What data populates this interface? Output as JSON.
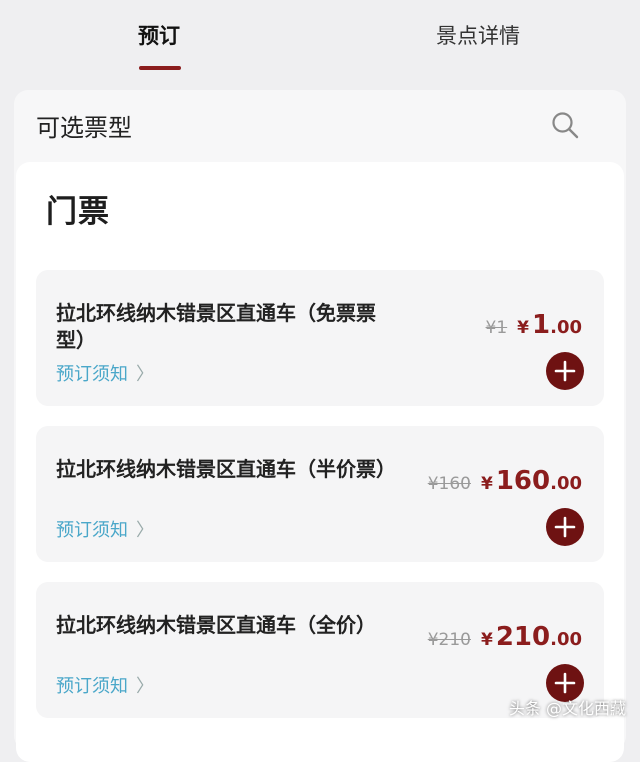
{
  "tabs": [
    {
      "label": "预订",
      "active": true
    },
    {
      "label": "景点详情",
      "active": false
    }
  ],
  "panel": {
    "title": "可选票型",
    "search_icon": "search-icon"
  },
  "section": {
    "title": "门票"
  },
  "tickets": [
    {
      "name": "拉北环线纳木错景区直通车（免票票型）",
      "link": "预订须知",
      "original_price": "¥1",
      "currency": "¥",
      "price_int": "1",
      "price_dec": ".00"
    },
    {
      "name": "拉北环线纳木错景区直通车（半价票）",
      "link": "预订须知",
      "original_price": "¥160",
      "currency": "¥",
      "price_int": "160",
      "price_dec": ".00"
    },
    {
      "name": "拉北环线纳木错景区直通车（全价）",
      "link": "预订须知",
      "original_price": "¥210",
      "currency": "¥",
      "price_int": "210",
      "price_dec": ".00"
    }
  ],
  "watermark": "头条 @文化西藏",
  "colors": {
    "accent": "#8b1d1d",
    "button": "#6e1212",
    "link": "#4aa7c9"
  }
}
